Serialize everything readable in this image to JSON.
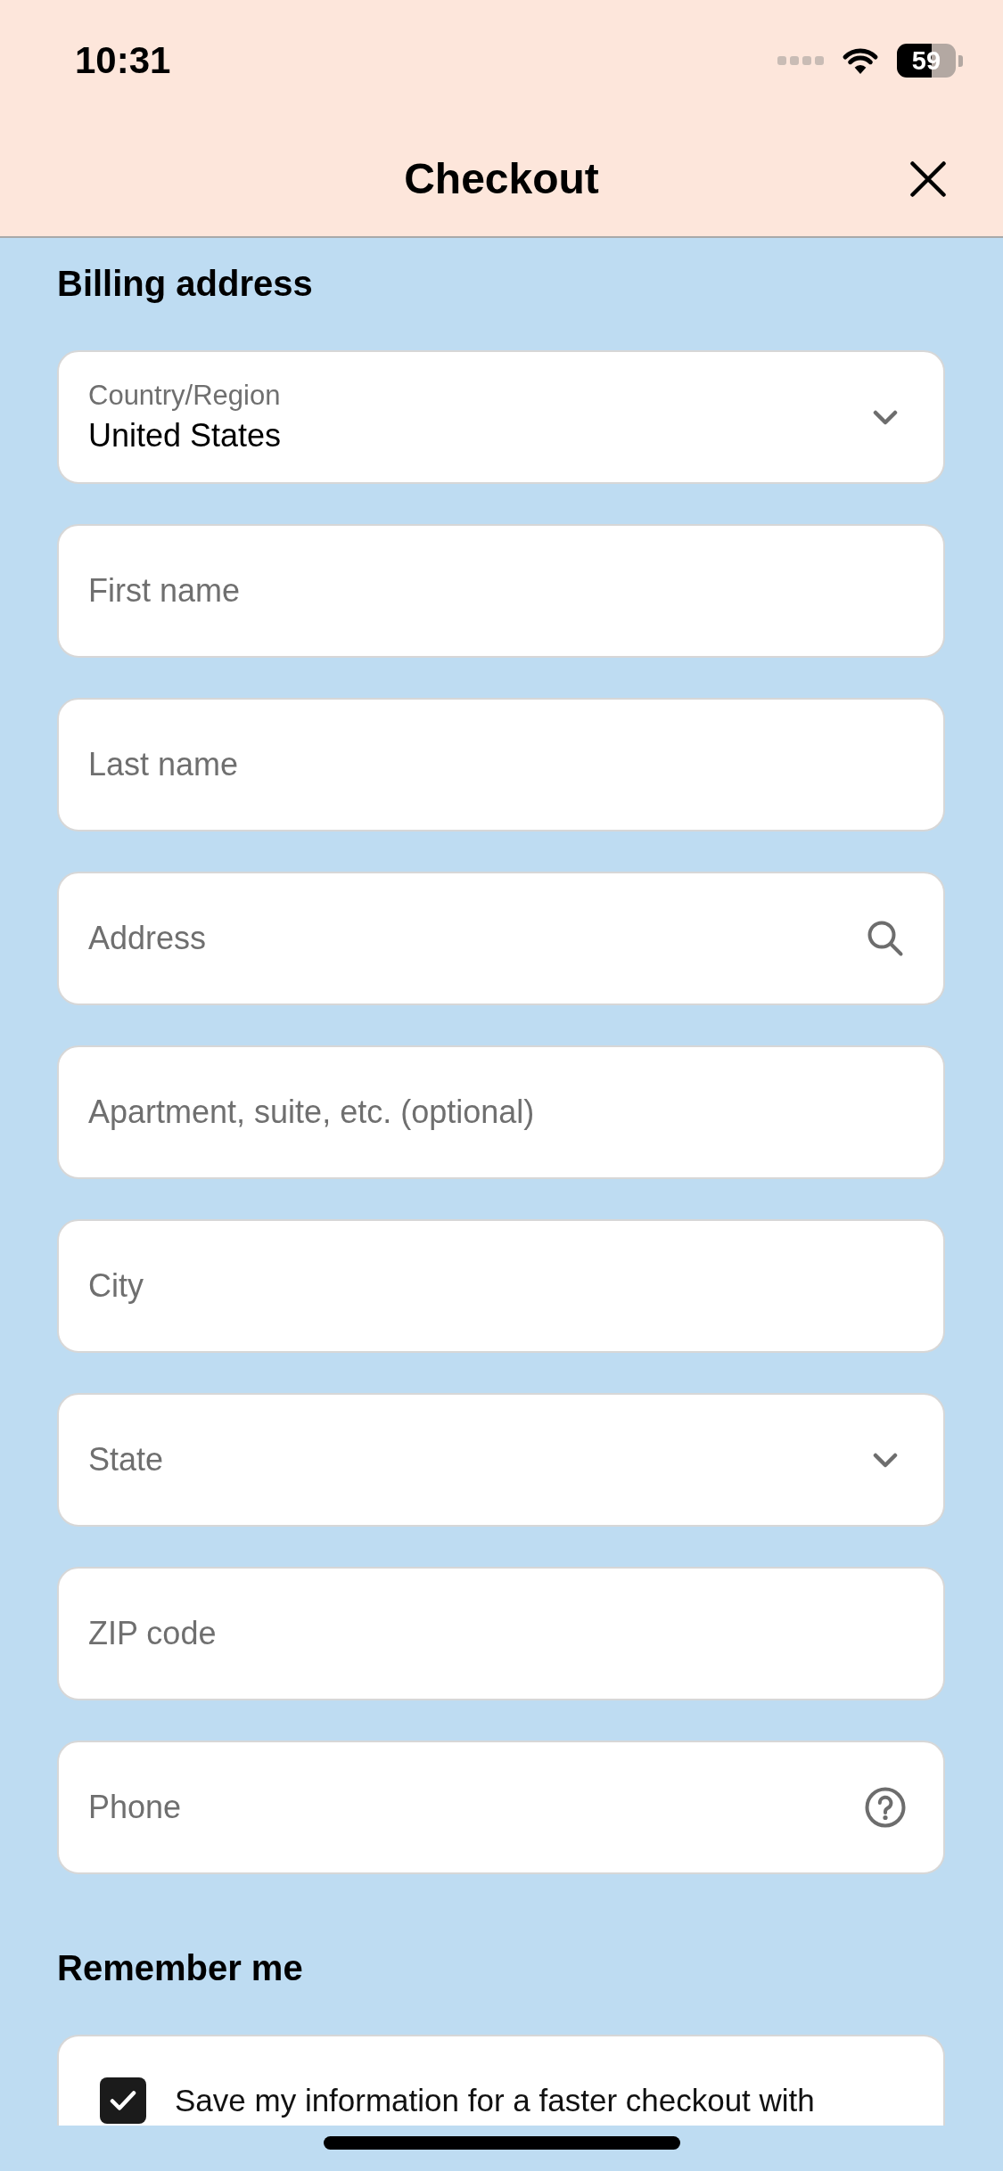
{
  "status_bar": {
    "time": "10:31",
    "battery": "59"
  },
  "header": {
    "title": "Checkout"
  },
  "billing": {
    "heading": "Billing address",
    "fields": [
      {
        "kind": "select",
        "label": "Country/Region",
        "value": "United States"
      },
      {
        "kind": "text",
        "placeholder": "First name"
      },
      {
        "kind": "text",
        "placeholder": "Last name"
      },
      {
        "kind": "search",
        "placeholder": "Address"
      },
      {
        "kind": "text",
        "placeholder": "Apartment, suite, etc. (optional)"
      },
      {
        "kind": "text",
        "placeholder": "City"
      },
      {
        "kind": "select",
        "placeholder": "State"
      },
      {
        "kind": "text",
        "placeholder": "ZIP code"
      },
      {
        "kind": "help",
        "placeholder": "Phone"
      }
    ]
  },
  "remember": {
    "heading": "Remember me",
    "option": {
      "label": "Save my information for a faster checkout with",
      "checked": true
    }
  }
}
